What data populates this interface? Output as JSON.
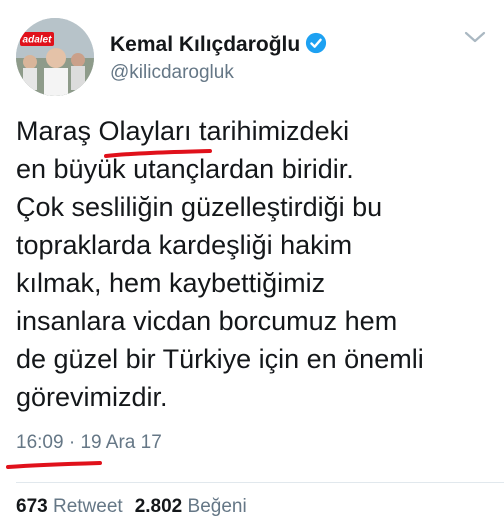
{
  "author": {
    "name": "Kemal Kılıçdaroğlu",
    "handle": "@kilicdarogluk",
    "avatar_badge": "adalet"
  },
  "tweet": {
    "lines": [
      "Maraş Olayları tarihimizdeki",
      "en büyük utançlardan biridir.",
      "Çok sesliliğin güzelleştirdiği bu",
      "topraklarda kardeşliği hakim",
      "kılmak, hem kaybettiğimiz",
      "insanlara vicdan borcumuz hem",
      "de güzel bir Türkiye için en önemli",
      "görevimizdir."
    ],
    "time": "16:09",
    "separator": "·",
    "date": "19 Ara 17"
  },
  "stats": {
    "retweets": "673",
    "retweet_label": "Retweet",
    "likes": "2.802",
    "like_label": "Beğeni"
  },
  "colors": {
    "verified": "#1da1f2",
    "annotation": "#e0111b",
    "secondary_text": "#657786"
  },
  "icons": {
    "verified": "verified-badge-icon",
    "menu": "chevron-down-icon"
  }
}
